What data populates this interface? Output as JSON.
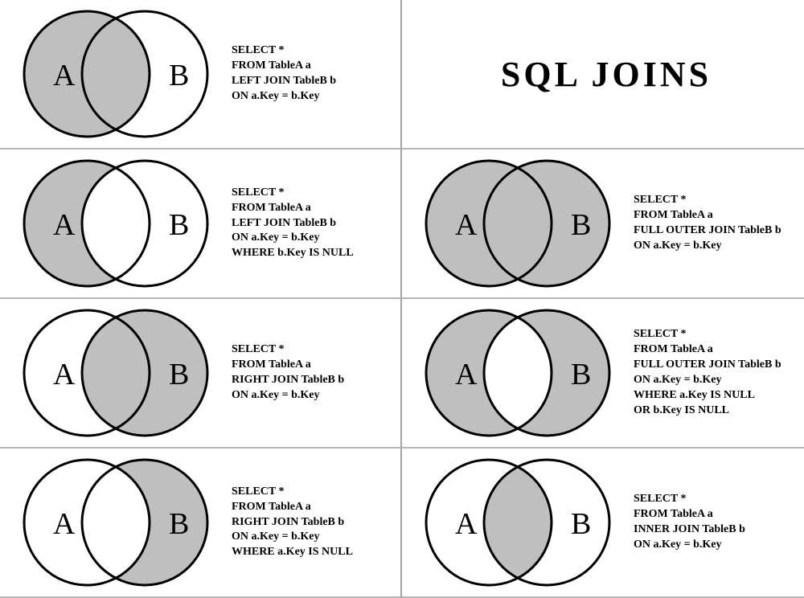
{
  "title": "SQL   JOINS",
  "labels": {
    "A": "A",
    "B": "B"
  },
  "colors": {
    "fill": "#bfbfbf",
    "stroke": "#000000",
    "divider": "#b5b5b5"
  },
  "panels": [
    {
      "id": "left-join",
      "sql": "SELECT *\nFROM TableA a\nLEFT JOIN TableB b\nON a.Key = b.Key",
      "venn": {
        "a_only": true,
        "b_only": false,
        "intersection": true
      }
    },
    {
      "id": "left-excl",
      "sql": "SELECT *\nFROM TableA a\nLEFT JOIN TableB b\nON a.Key = b.Key\nWHERE b.Key IS NULL",
      "venn": {
        "a_only": true,
        "b_only": false,
        "intersection": false
      }
    },
    {
      "id": "full-outer",
      "sql": "SELECT *\nFROM TableA a\nFULL OUTER JOIN TableB b\nON a.Key = b.Key",
      "venn": {
        "a_only": true,
        "b_only": true,
        "intersection": true
      }
    },
    {
      "id": "right-join",
      "sql": "SELECT *\nFROM TableA a\nRIGHT JOIN TableB b\nON a.Key = b.Key",
      "venn": {
        "a_only": false,
        "b_only": true,
        "intersection": true
      }
    },
    {
      "id": "full-outer-excl",
      "sql": "SELECT *\nFROM TableA a\nFULL OUTER JOIN TableB b\nON a.Key = b.Key\nWHERE a.Key IS NULL\nOR b.Key IS NULL",
      "venn": {
        "a_only": true,
        "b_only": true,
        "intersection": false
      }
    },
    {
      "id": "right-excl",
      "sql": "SELECT *\nFROM TableA a\nRIGHT JOIN TableB b\nON a.Key = b.Key\nWHERE a.Key IS NULL",
      "venn": {
        "a_only": false,
        "b_only": true,
        "intersection": false
      }
    },
    {
      "id": "inner-join",
      "sql": "SELECT *\nFROM TableA a\nINNER JOIN TableB b\nON a.Key = b.Key",
      "venn": {
        "a_only": false,
        "b_only": false,
        "intersection": true
      }
    }
  ]
}
